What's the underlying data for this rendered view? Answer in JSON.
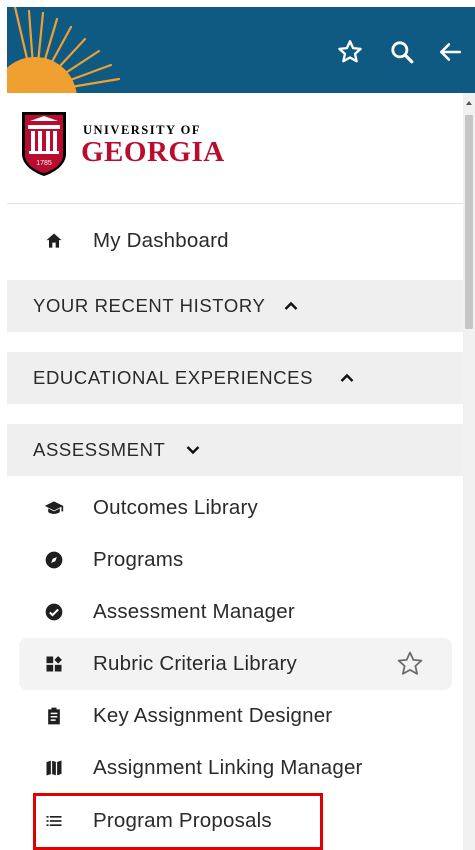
{
  "logo": {
    "line1": "UNIVERSITY OF",
    "line2": "GEORGIA",
    "year": "1785"
  },
  "top_icons": [
    "star-outline-icon",
    "search-icon",
    "arrow-back-icon"
  ],
  "dashboard": {
    "label": "My Dashboard",
    "icon": "home-icon"
  },
  "sections": {
    "recent": {
      "label": "YOUR RECENT HISTORY",
      "state": "collapsed-up-caret"
    },
    "educational": {
      "label": "EDUCATIONAL EXPERIENCES",
      "state": "collapsed-up-caret"
    },
    "assessment": {
      "label": "ASSESSMENT",
      "state": "expanded-down-caret"
    }
  },
  "assessment_items": [
    {
      "label": "Outcomes Library",
      "icon": "graduation-cap-icon"
    },
    {
      "label": "Programs",
      "icon": "compass-icon"
    },
    {
      "label": "Assessment Manager",
      "icon": "check-circle-icon"
    },
    {
      "label": "Rubric Criteria Library",
      "icon": "dashboard-grid-icon"
    },
    {
      "label": "Key Assignment Designer",
      "icon": "clipboard-icon"
    },
    {
      "label": "Assignment Linking Manager",
      "icon": "map-icon"
    },
    {
      "label": "Program Proposals",
      "icon": "list-icon"
    }
  ],
  "colors": {
    "header": "#0f5a82",
    "sun": "#f0a030",
    "brand_red": "#ba0c2f",
    "section_bg": "#efefef",
    "highlight": "#e00000"
  }
}
